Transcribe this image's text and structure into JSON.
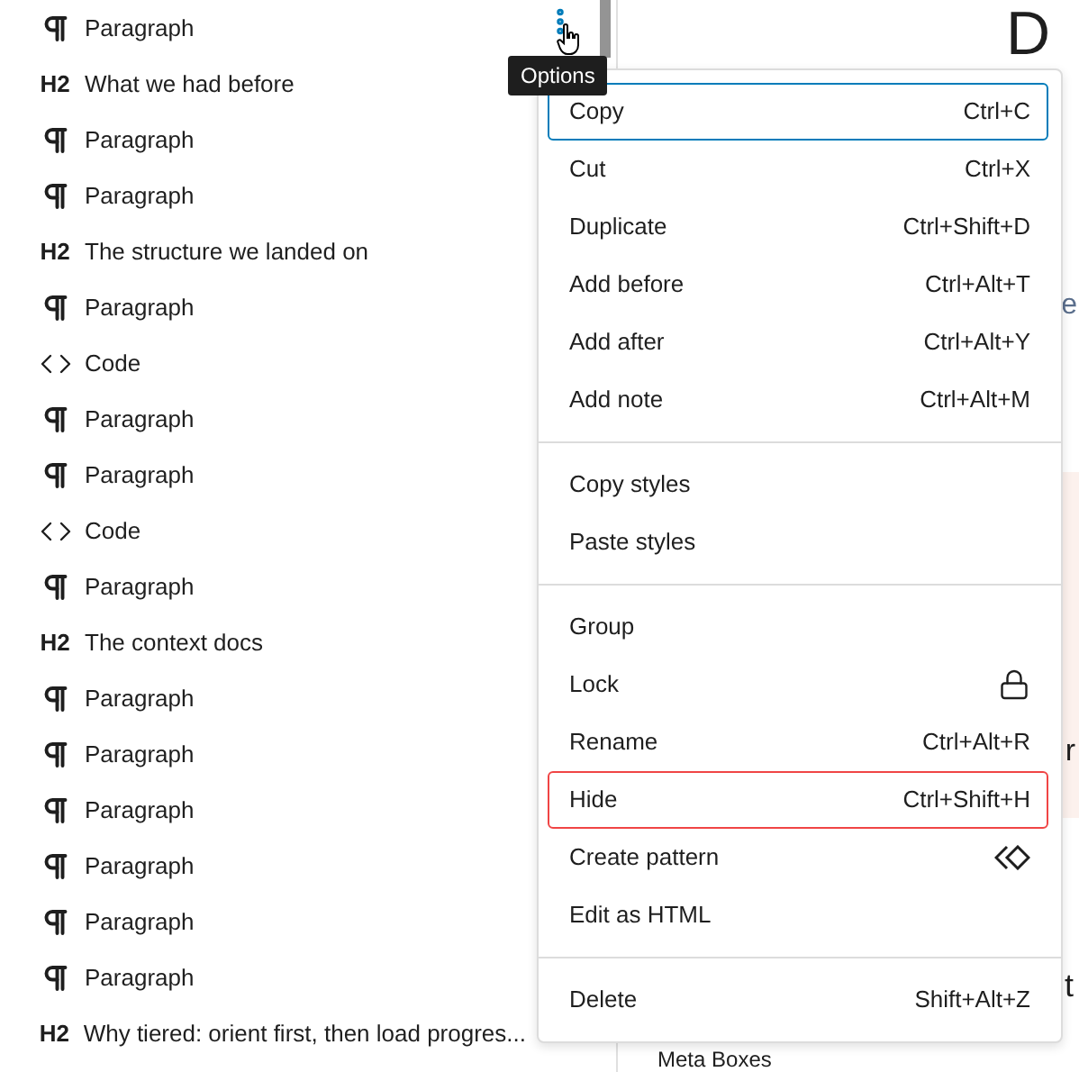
{
  "list_view": {
    "rows": [
      {
        "kind": "paragraph",
        "label": "Paragraph"
      },
      {
        "kind": "heading",
        "badge": "H2",
        "label": "What we had before"
      },
      {
        "kind": "paragraph",
        "label": "Paragraph"
      },
      {
        "kind": "paragraph",
        "label": "Paragraph"
      },
      {
        "kind": "heading",
        "badge": "H2",
        "label": "The structure we landed on"
      },
      {
        "kind": "paragraph",
        "label": "Paragraph"
      },
      {
        "kind": "code",
        "label": "Code"
      },
      {
        "kind": "paragraph",
        "label": "Paragraph"
      },
      {
        "kind": "paragraph",
        "label": "Paragraph"
      },
      {
        "kind": "code",
        "label": "Code"
      },
      {
        "kind": "paragraph",
        "label": "Paragraph"
      },
      {
        "kind": "heading",
        "badge": "H2",
        "label": "The context docs"
      },
      {
        "kind": "paragraph",
        "label": "Paragraph"
      },
      {
        "kind": "paragraph",
        "label": "Paragraph"
      },
      {
        "kind": "paragraph",
        "label": "Paragraph"
      },
      {
        "kind": "paragraph",
        "label": "Paragraph"
      },
      {
        "kind": "paragraph",
        "label": "Paragraph"
      },
      {
        "kind": "paragraph",
        "label": "Paragraph"
      },
      {
        "kind": "heading",
        "badge": "H2",
        "label": "Why tiered: orient first, then load progres..."
      }
    ]
  },
  "tooltip": "Options",
  "options_menu": {
    "groups": [
      [
        {
          "kind": "shortcut",
          "label": "Copy",
          "shortcut": "Ctrl+C",
          "focused": true,
          "highlighted": false
        },
        {
          "kind": "shortcut",
          "label": "Cut",
          "shortcut": "Ctrl+X",
          "focused": false,
          "highlighted": false
        },
        {
          "kind": "shortcut",
          "label": "Duplicate",
          "shortcut": "Ctrl+Shift+D",
          "focused": false,
          "highlighted": false
        },
        {
          "kind": "shortcut",
          "label": "Add before",
          "shortcut": "Ctrl+Alt+T",
          "focused": false,
          "highlighted": false
        },
        {
          "kind": "shortcut",
          "label": "Add after",
          "shortcut": "Ctrl+Alt+Y",
          "focused": false,
          "highlighted": false
        },
        {
          "kind": "shortcut",
          "label": "Add note",
          "shortcut": "Ctrl+Alt+M",
          "focused": false,
          "highlighted": false
        }
      ],
      [
        {
          "kind": "plain",
          "label": "Copy styles",
          "focused": false,
          "highlighted": false
        },
        {
          "kind": "plain",
          "label": "Paste styles",
          "focused": false,
          "highlighted": false
        }
      ],
      [
        {
          "kind": "plain",
          "label": "Group",
          "focused": false,
          "highlighted": false
        },
        {
          "kind": "lock",
          "label": "Lock",
          "focused": false,
          "highlighted": false
        },
        {
          "kind": "shortcut",
          "label": "Rename",
          "shortcut": "Ctrl+Alt+R",
          "focused": false,
          "highlighted": false
        },
        {
          "kind": "shortcut",
          "label": "Hide",
          "shortcut": "Ctrl+Shift+H",
          "focused": false,
          "highlighted": true
        },
        {
          "kind": "pattern",
          "label": "Create pattern",
          "focused": false,
          "highlighted": false
        },
        {
          "kind": "plain",
          "label": "Edit as HTML",
          "focused": false,
          "highlighted": false
        }
      ],
      [
        {
          "kind": "shortcut",
          "label": "Delete",
          "shortcut": "Shift+Alt+Z",
          "focused": false,
          "highlighted": false
        }
      ]
    ]
  },
  "editor": {
    "title": "D",
    "meta": "e",
    "callout_text": "r",
    "body_text": "t",
    "footer": "Meta Boxes"
  }
}
